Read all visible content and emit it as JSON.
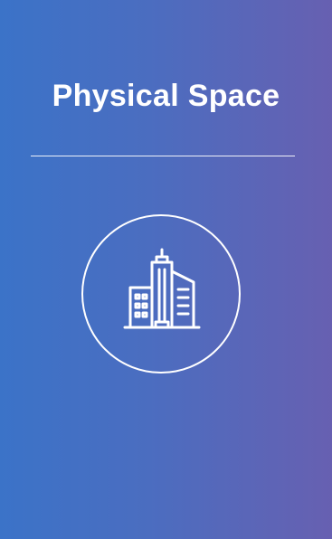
{
  "card": {
    "title": "Physical Space",
    "icon": "buildings-icon",
    "gradient_start": "#3b73c8",
    "gradient_end": "#6760b1",
    "foreground": "#ffffff"
  }
}
